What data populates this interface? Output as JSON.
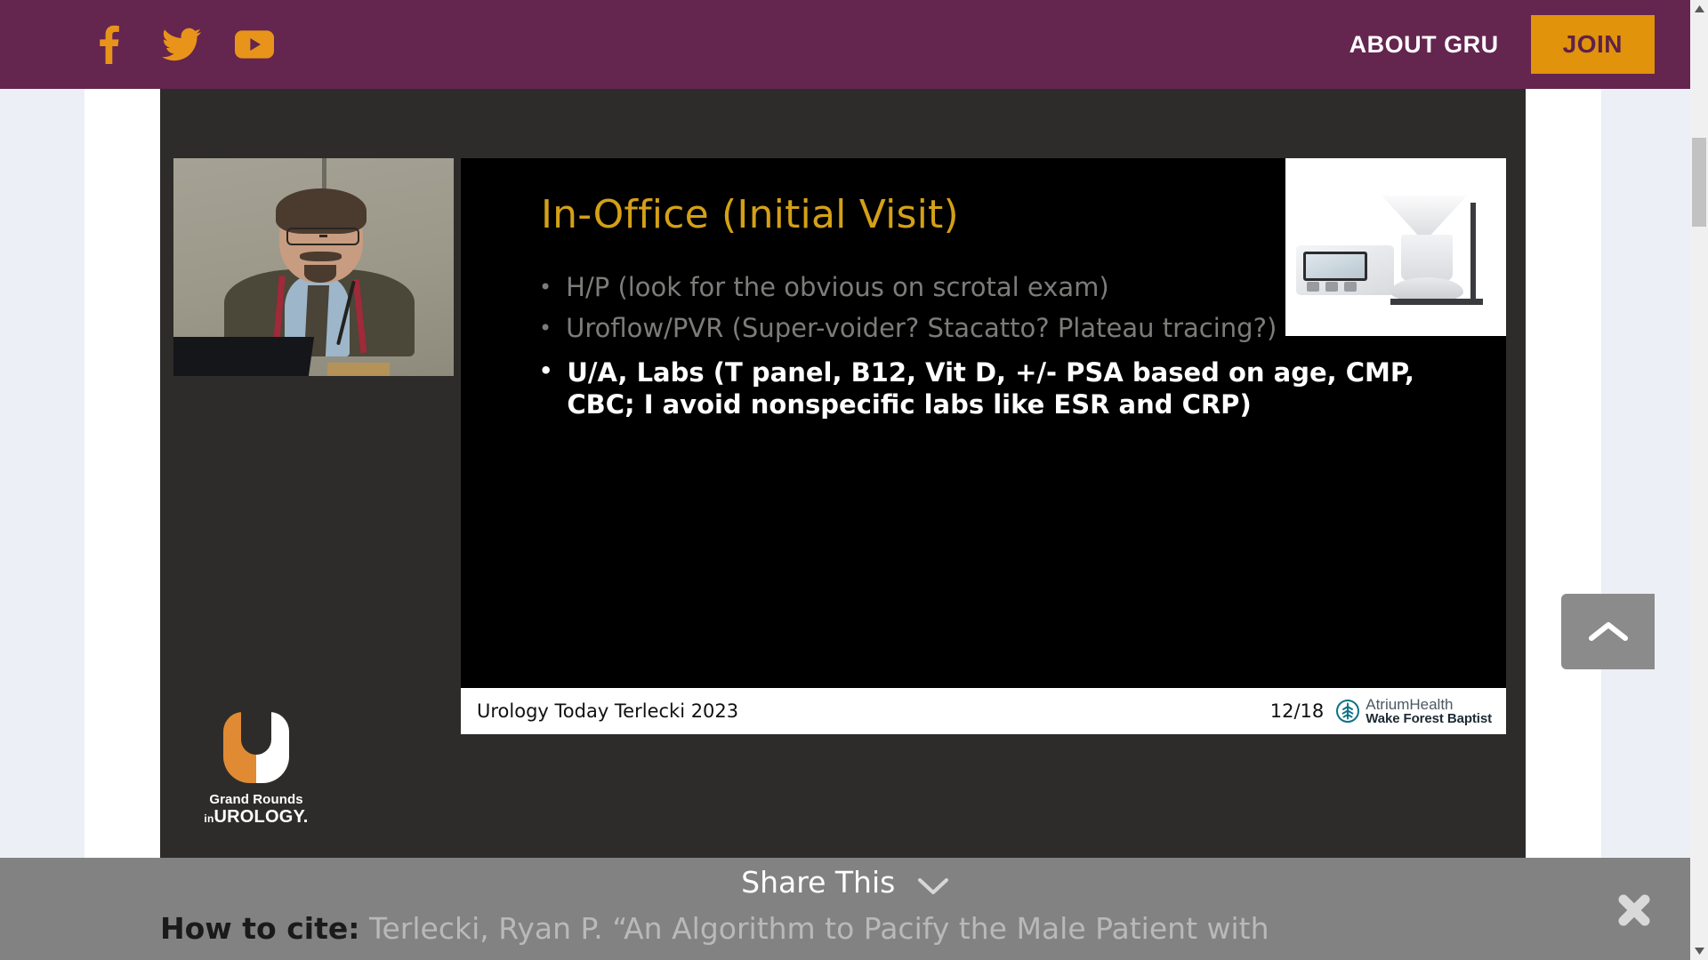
{
  "header": {
    "social": [
      {
        "name": "facebook-icon",
        "label": "Facebook"
      },
      {
        "name": "twitter-icon",
        "label": "Twitter"
      },
      {
        "name": "youtube-icon",
        "label": "YouTube"
      }
    ],
    "about_label": "ABOUT GRU",
    "join_label": "JOIN",
    "bg_color": "#64254f",
    "accent_color": "#e0930b"
  },
  "slide": {
    "title": "In-Office (Initial Visit)",
    "title_color": "#d4a017",
    "bullets": [
      {
        "text": "H/P (look for the obvious on scrotal exam)",
        "state": "dim"
      },
      {
        "text": "Uroflow/PVR (Super-voider? Stacatto? Plateau tracing?)",
        "state": "dim"
      },
      {
        "text": "U/A, Labs (T panel, B12, Vit D, +/- PSA based on age, CMP, CBC; I avoid nonspecific labs like ESR and CRP)",
        "state": "highlighted"
      }
    ],
    "image_caption": "uroflowmetry-device-photo",
    "footer": {
      "citation": "Urology Today Terlecki 2023",
      "page": "12/18",
      "logo_line1_bold": "Atrium",
      "logo_line1_light": "Health",
      "logo_line2": "Wake Forest Baptist",
      "logo_color": "#0b7285"
    }
  },
  "watermark": {
    "line1": "Grand Rounds",
    "line2_prefix": "in",
    "line2": "UROLOGY.",
    "orange": "#e08b33"
  },
  "share_bar": {
    "title": "Share This",
    "cite_label": "How to cite:",
    "cite_text": "Terlecki, Ryan P. “An Algorithm to Pacify the Male Patient with",
    "close_label": "Close",
    "bg_color": "#828282"
  },
  "controls": {
    "scroll_top_label": "Back to top"
  }
}
